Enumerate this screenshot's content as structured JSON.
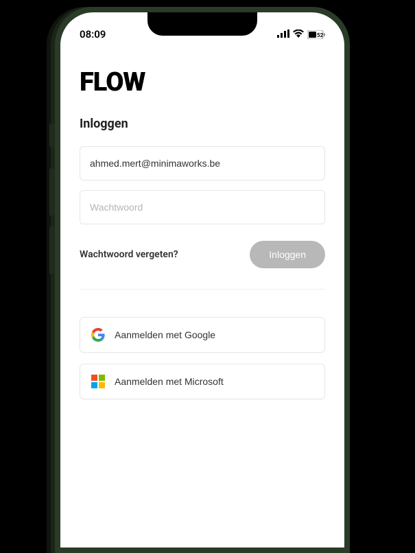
{
  "status": {
    "time": "08:09",
    "battery": "52"
  },
  "logo": "FLOW",
  "heading": "Inloggen",
  "email": {
    "value": "ahmed.mert@minimaworks.be"
  },
  "password": {
    "placeholder": "Wachtwoord"
  },
  "forgot_label": "Wachtwoord vergeten?",
  "login_button": "Inloggen",
  "sso": {
    "google": "Aanmelden met Google",
    "microsoft": "Aanmelden met Microsoft"
  }
}
